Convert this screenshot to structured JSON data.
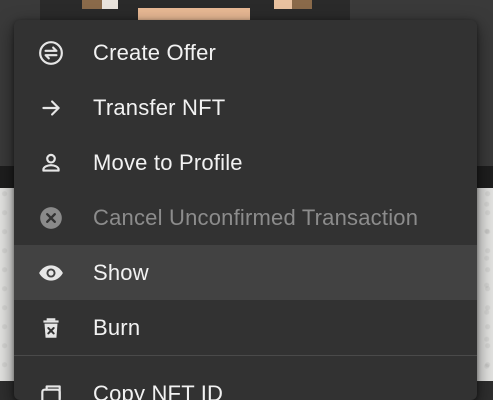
{
  "menu": {
    "items": [
      {
        "label": "Create Offer",
        "icon": "swap-circle-icon",
        "disabled": false
      },
      {
        "label": "Transfer NFT",
        "icon": "arrow-right-icon",
        "disabled": false
      },
      {
        "label": "Move to Profile",
        "icon": "person-icon",
        "disabled": false
      },
      {
        "label": "Cancel Unconfirmed Transaction",
        "icon": "cancel-circle-icon",
        "disabled": true
      },
      {
        "label": "Show",
        "icon": "eye-icon",
        "disabled": false,
        "hovered": true
      },
      {
        "label": "Burn",
        "icon": "delete-icon",
        "disabled": false
      },
      {
        "label": "Copy NFT ID",
        "icon": "copy-icon",
        "disabled": false
      }
    ]
  },
  "colors": {
    "menu_background": "#323232",
    "hover_background": "#424242",
    "text": "#f2f2f2",
    "disabled_text": "#8c8c8c"
  }
}
